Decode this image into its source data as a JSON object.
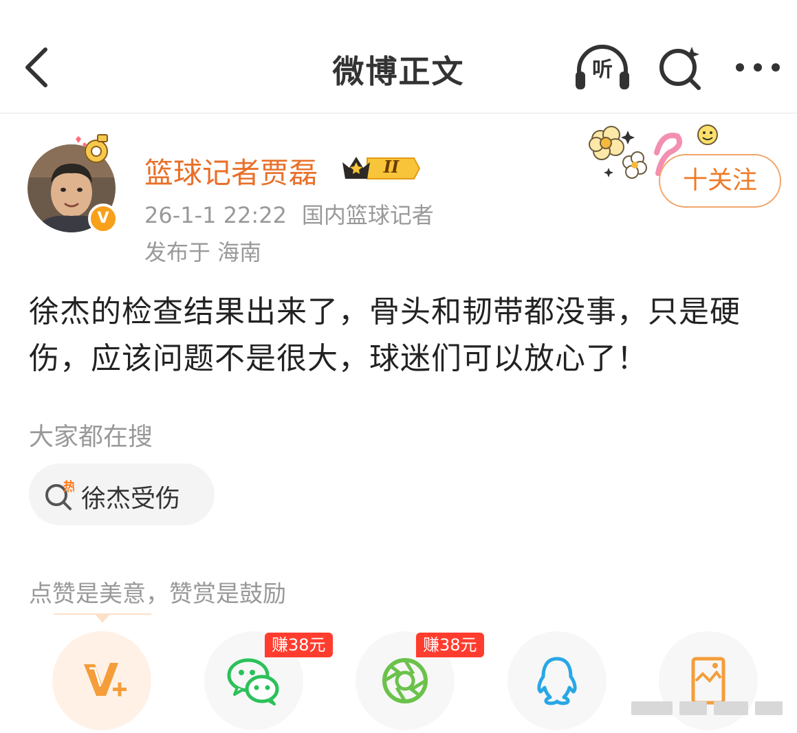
{
  "header": {
    "title": "微博正文",
    "listen_label": "听"
  },
  "author": {
    "name": "篮球记者贾磊",
    "level": "II",
    "verified_mark": "V",
    "time": "26-1-1 22:22",
    "description": "国内篮球记者",
    "location": "发布于 海南",
    "follow_label": "十关注"
  },
  "post": {
    "text": "徐杰的检查结果出来了，骨头和韧带都没事，只是硬伤，应该问题不是很大，球迷们可以放心了！"
  },
  "hot_search": {
    "title": "大家都在搜",
    "chip_label": "徐杰受伤",
    "chip_icon_text": "热"
  },
  "reward": {
    "hint": "点赞是美意，赞赏是鼓励"
  },
  "share": {
    "items": [
      {
        "name": "reward-v-plus",
        "icon": "v-plus-icon"
      },
      {
        "name": "wechat",
        "icon": "wechat-icon",
        "tag": "赚38元"
      },
      {
        "name": "moments",
        "icon": "moments-icon",
        "tag": "赚38元"
      },
      {
        "name": "qq",
        "icon": "qq-icon"
      },
      {
        "name": "save-image",
        "icon": "image-icon"
      }
    ]
  },
  "colors": {
    "accent": "#ef7a26",
    "username": "#e8702a",
    "meta": "#999999",
    "earn_tag": "#ff3d2e",
    "wechat_green": "#2bc15a",
    "qq_blue": "#28a7e6"
  }
}
